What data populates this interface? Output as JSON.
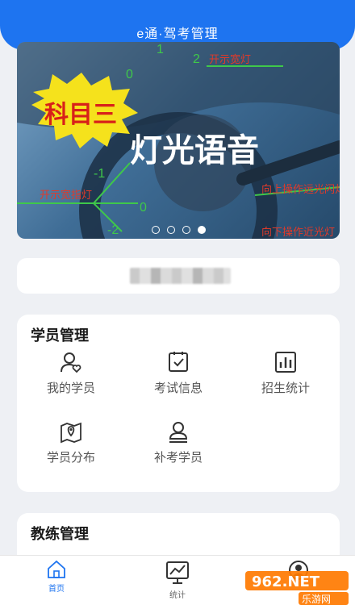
{
  "header": {
    "title": "e通·驾考管理"
  },
  "banner": {
    "badge": "科目三",
    "headline": "灯光语音",
    "annotations": [
      "开示宽指灯",
      "开示宽灯",
      "向上操作远光闪灯",
      "向下操作近光灯"
    ],
    "numbers": [
      "1",
      "2",
      "0",
      "-1",
      "-2",
      "0"
    ],
    "dots_total": 4,
    "dots_active": 4
  },
  "user_card": {
    "name_redacted": ""
  },
  "student_section": {
    "title": "学员管理",
    "items": [
      {
        "label": "我的学员",
        "icon": "students-icon"
      },
      {
        "label": "考试信息",
        "icon": "exam-info-icon"
      },
      {
        "label": "招生统计",
        "icon": "enrollment-stats-icon"
      },
      {
        "label": "学员分布",
        "icon": "map-pin-icon"
      },
      {
        "label": "补考学员",
        "icon": "retake-student-icon"
      }
    ]
  },
  "coach_section": {
    "title": "教练管理"
  },
  "tabbar": {
    "tabs": [
      {
        "label": "首页",
        "icon": "home-icon",
        "active": true
      },
      {
        "label": "统计",
        "icon": "chart-icon",
        "active": false
      },
      {
        "label": "",
        "icon": "profile-icon",
        "active": false
      }
    ]
  },
  "watermark": {
    "logo_text": "962.NET",
    "sub_text": "乐游网"
  },
  "colors": {
    "primary": "#1e74f0",
    "background": "#eef0f4",
    "badge_yellow": "#f5e21c",
    "badge_red": "#d8201a"
  }
}
